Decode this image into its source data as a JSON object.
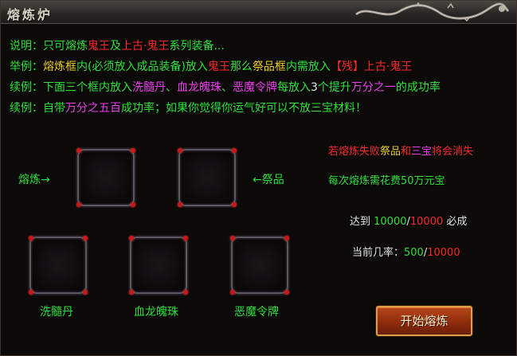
{
  "window": {
    "title": "熔炼炉"
  },
  "instructions": {
    "line1": {
      "prefix": "说明：只可熔炼",
      "a": "鬼王",
      "b": "及",
      "c": "上古·鬼王",
      "d": "系列装备..."
    },
    "line2": {
      "prefix": "举例：",
      "a": "熔炼框",
      "b": "内(必须放入成品装备)放入",
      "c": "鬼王",
      "d": "那么",
      "e": "祭品框",
      "f": "内需放入",
      "g": "【残】上古·鬼王"
    },
    "line3": {
      "prefix": "续例：下面三个框内放入",
      "a": "洗髓丹",
      "b": "、",
      "c": "血龙魄珠",
      "d": "、",
      "e": "恶魔令牌",
      "f": "每放入",
      "g": "3",
      "h": "个提升",
      "i": "万分之一",
      "j": "的成功率"
    },
    "line4": {
      "prefix": "续例：自带",
      "a": "万分之五百",
      "b": "成功率；如果你觉得你运气好可以不放三宝材料！"
    }
  },
  "slots": {
    "smelt_label": "熔炼→",
    "offering_label": "←祭品",
    "material1": "洗髓丹",
    "material2": "血龙魄珠",
    "material3": "恶魔令牌"
  },
  "info": {
    "warn_a": "若熔炼失败",
    "warn_b": "祭品",
    "warn_c": "和",
    "warn_d": "三宝",
    "warn_e": "将会消失",
    "cost": "每次熔炼需花费50万元宝",
    "reach_prefix": "达到 ",
    "reach_cur": "10000",
    "reach_sep": "/",
    "reach_max": "10000",
    "reach_suffix": " 必成",
    "rate_prefix": "当前几率：",
    "rate_cur": "500",
    "rate_sep": "/",
    "rate_max": "10000"
  },
  "button": {
    "start": "开始熔炼"
  },
  "colors": {
    "green": "#30e33a",
    "yellow": "#f0d020",
    "red": "#ff2a2a",
    "pink": "#f040f0",
    "button": "#b8461a"
  }
}
